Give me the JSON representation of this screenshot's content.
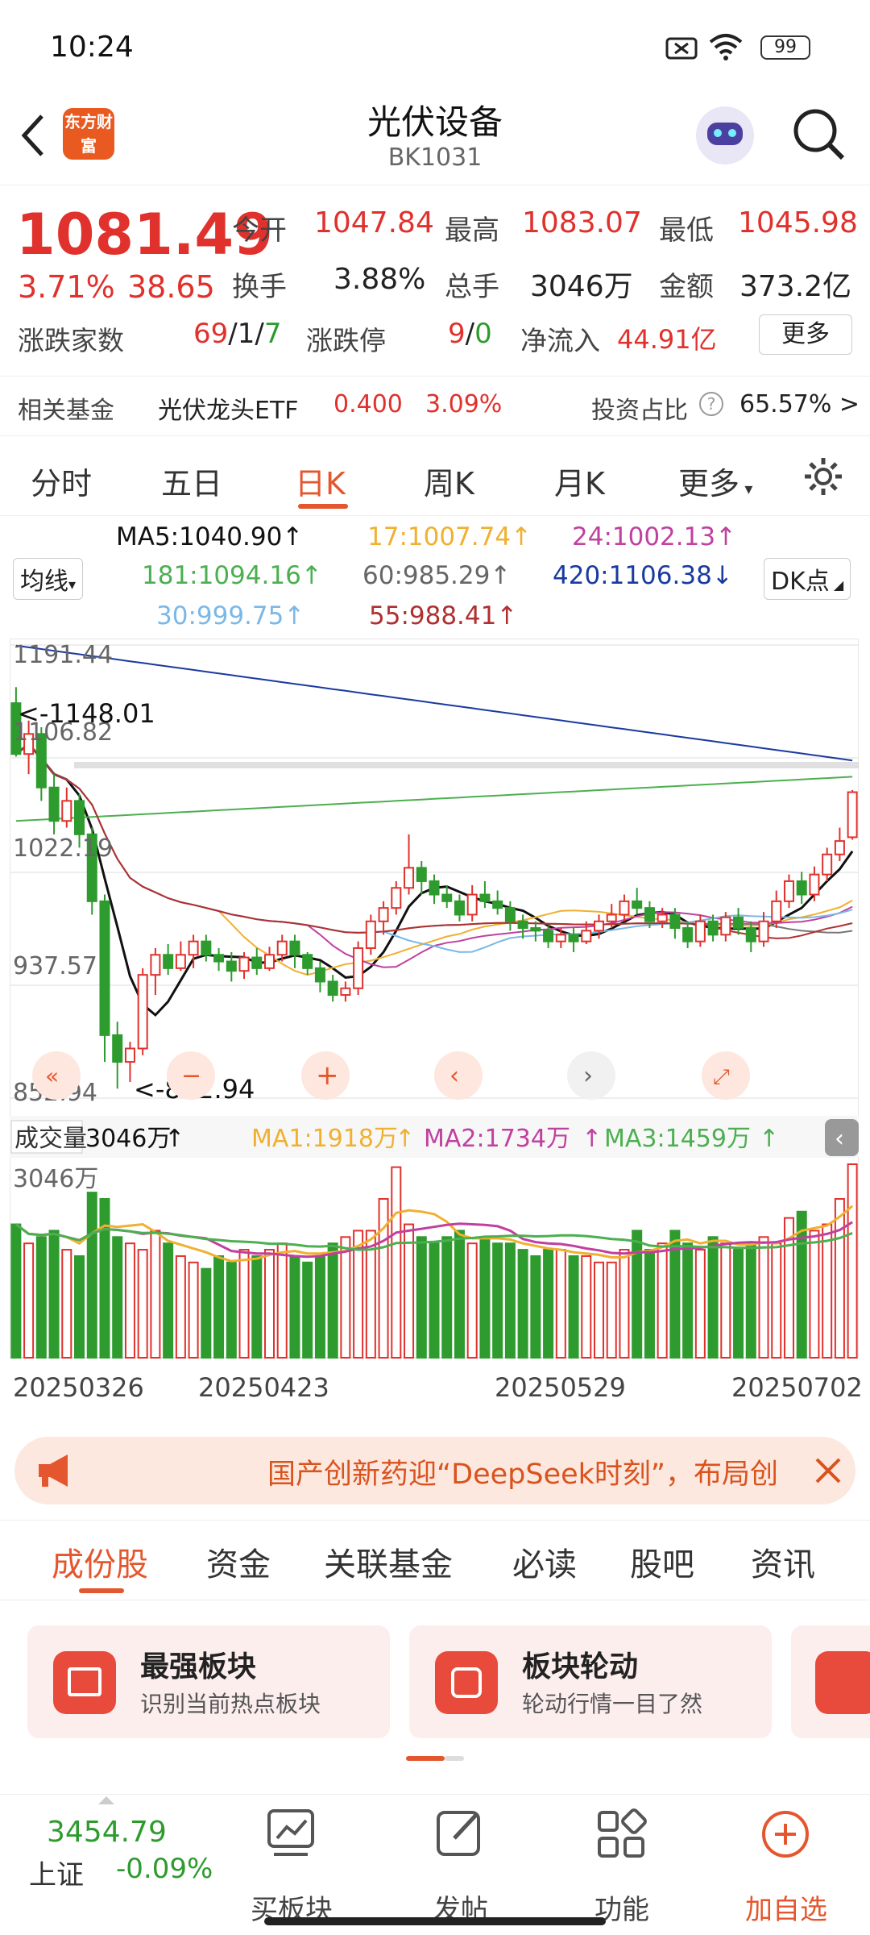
{
  "status_bar": {
    "time": "10:24",
    "battery": "99"
  },
  "header": {
    "title": "光伏设备",
    "code": "BK1031",
    "logo_text": "东方财富"
  },
  "quote": {
    "price": "1081.49",
    "change_pct": "3.71%",
    "change": "38.65",
    "open_label": "今开",
    "open": "1047.84",
    "high_label": "最高",
    "high": "1083.07",
    "low_label": "最低",
    "low": "1045.98",
    "turnover_label": "换手",
    "turnover": "3.88%",
    "volume_label": "总手",
    "volume": "3046万",
    "amount_label": "金额",
    "amount": "373.2亿",
    "breadth_label": "涨跌家数",
    "breadth_up": "69",
    "breadth_flat": "1",
    "breadth_down": "7",
    "limit_label": "涨跌停",
    "limit_up": "9",
    "limit_down": "0",
    "netflow_label": "净流入",
    "netflow": "44.91亿",
    "more_label": "更多"
  },
  "fund": {
    "label": "相关基金",
    "name": "光伏龙头ETF",
    "price": "0.400",
    "pct": "3.09%",
    "ratio_label": "投资占比",
    "ratio": "65.57%"
  },
  "tabs": [
    "分时",
    "五日",
    "日K",
    "周K",
    "月K",
    "更多"
  ],
  "ma": {
    "selector": "均线",
    "ma5": "MA5:1040.90",
    "ma17": "17:1007.74",
    "ma24": "24:1002.13",
    "ma181": "181:1094.16",
    "ma60": "60:985.29",
    "ma420": "420:1106.38",
    "ma30": "30:999.75",
    "ma55": "55:988.41",
    "dk": "DK点"
  },
  "chart_labels": {
    "y_top": "1191.44",
    "y_2": "1106.82",
    "y_3": "1022.19",
    "y_4": "937.57",
    "y_bottom": "852.94",
    "high_mark": "<-1148.01",
    "low_mark": "<-852.94"
  },
  "volume": {
    "selector": "成交量",
    "current": "3046万",
    "ma1": "MA1:1918万",
    "ma2": "MA2:1734万",
    "ma3": "MA3:1459万",
    "axis_max": "3046万"
  },
  "dates": [
    "20250326",
    "20250423",
    "20250529",
    "20250702"
  ],
  "banner": {
    "text": "国产创新药迎“DeepSeek时刻”，布局创"
  },
  "subtabs": [
    "成份股",
    "资金",
    "关联基金",
    "必读",
    "股吧",
    "资讯"
  ],
  "cards": [
    {
      "title": "最强板块",
      "desc": "识别当前热点板块"
    },
    {
      "title": "板块轮动",
      "desc": "轮动行情一目了然"
    }
  ],
  "bottom": {
    "index_value": "3454.79",
    "index_name": "上证",
    "index_pct": "-0.09%",
    "nav": [
      "买板块",
      "发帖",
      "功能",
      "加自选"
    ]
  },
  "colors": {
    "red": "#e0312c",
    "green": "#2e9b2e",
    "accent": "#e4572e"
  },
  "chart_data": {
    "type": "candlestick",
    "ylim": [
      852.94,
      1191.44
    ],
    "candles": [
      [
        1148,
        1110,
        1160,
        1108
      ],
      [
        1110,
        1125,
        1135,
        1095
      ],
      [
        1125,
        1085,
        1130,
        1075
      ],
      [
        1085,
        1060,
        1095,
        1050
      ],
      [
        1060,
        1075,
        1085,
        1055
      ],
      [
        1075,
        1050,
        1080,
        1040
      ],
      [
        1050,
        1000,
        1055,
        990
      ],
      [
        1000,
        900,
        1005,
        880
      ],
      [
        900,
        880,
        910,
        860
      ],
      [
        880,
        890,
        895,
        865
      ],
      [
        890,
        945,
        950,
        885
      ],
      [
        945,
        960,
        965,
        930
      ],
      [
        960,
        950,
        968,
        945
      ],
      [
        950,
        960,
        970,
        948
      ],
      [
        960,
        970,
        975,
        950
      ],
      [
        970,
        960,
        975,
        955
      ],
      [
        960,
        955,
        965,
        948
      ],
      [
        955,
        948,
        962,
        940
      ],
      [
        948,
        958,
        962,
        942
      ],
      [
        958,
        950,
        965,
        945
      ],
      [
        950,
        960,
        966,
        948
      ],
      [
        960,
        970,
        975,
        955
      ],
      [
        970,
        960,
        975,
        950
      ],
      [
        960,
        950,
        962,
        945
      ],
      [
        950,
        940,
        955,
        932
      ],
      [
        940,
        930,
        945,
        925
      ],
      [
        930,
        935,
        940,
        925
      ],
      [
        935,
        965,
        970,
        930
      ],
      [
        965,
        985,
        990,
        960
      ],
      [
        985,
        995,
        1000,
        975
      ],
      [
        995,
        1010,
        1015,
        990
      ],
      [
        1010,
        1025,
        1050,
        1005
      ],
      [
        1025,
        1015,
        1030,
        1005
      ],
      [
        1015,
        1005,
        1020,
        998
      ],
      [
        1005,
        1000,
        1012,
        995
      ],
      [
        1000,
        990,
        1005,
        985
      ],
      [
        990,
        1005,
        1012,
        985
      ],
      [
        1005,
        1000,
        1015,
        995
      ],
      [
        1000,
        995,
        1008,
        990
      ],
      [
        995,
        985,
        1000,
        978
      ],
      [
        985,
        980,
        990,
        972
      ],
      [
        980,
        978,
        985,
        970
      ],
      [
        978,
        970,
        982,
        965
      ],
      [
        970,
        975,
        980,
        965
      ],
      [
        975,
        970,
        980,
        962
      ],
      [
        970,
        978,
        985,
        968
      ],
      [
        978,
        985,
        990,
        972
      ],
      [
        985,
        990,
        998,
        980
      ],
      [
        990,
        1000,
        1005,
        985
      ],
      [
        1000,
        995,
        1010,
        990
      ],
      [
        995,
        985,
        1000,
        980
      ],
      [
        985,
        990,
        995,
        980
      ],
      [
        990,
        980,
        995,
        972
      ],
      [
        980,
        970,
        985,
        965
      ],
      [
        970,
        985,
        990,
        966
      ],
      [
        985,
        975,
        990,
        970
      ],
      [
        975,
        988,
        992,
        970
      ],
      [
        988,
        980,
        995,
        975
      ],
      [
        980,
        970,
        985,
        962
      ],
      [
        970,
        985,
        992,
        966
      ],
      [
        985,
        1000,
        1008,
        980
      ],
      [
        1000,
        1015,
        1020,
        995
      ],
      [
        1015,
        1005,
        1022,
        998
      ],
      [
        1005,
        1020,
        1026,
        1000
      ],
      [
        1020,
        1035,
        1040,
        1015
      ],
      [
        1035,
        1045,
        1055,
        1030
      ],
      [
        1047.84,
        1081.49,
        1083.07,
        1045.98
      ]
    ],
    "ma_series": [
      {
        "name": "MA5",
        "color": "#111111"
      },
      {
        "name": "17",
        "color": "#f0b030"
      },
      {
        "name": "24",
        "color": "#c040a0"
      },
      {
        "name": "181",
        "color": "#4caf50"
      },
      {
        "name": "60",
        "color": "#777777"
      },
      {
        "name": "420",
        "color": "#1a3aa0"
      },
      {
        "name": "30",
        "color": "#7ab8e8"
      },
      {
        "name": "55",
        "color": "#b03030"
      }
    ],
    "volume_values": [
      2100,
      1800,
      1900,
      2000,
      1700,
      1600,
      2600,
      2500,
      1900,
      1800,
      1700,
      2000,
      1800,
      1600,
      1500,
      1400,
      1600,
      1500,
      1700,
      1600,
      1700,
      1800,
      1600,
      1500,
      1600,
      1800,
      1900,
      2000,
      2000,
      2500,
      3000,
      2100,
      1900,
      1800,
      1900,
      2000,
      1800,
      1900,
      1800,
      1800,
      1700,
      1600,
      1700,
      1700,
      1600,
      1600,
      1500,
      1500,
      1700,
      2000,
      1700,
      1800,
      2000,
      1800,
      1700,
      1900,
      1800,
      1700,
      1800,
      1900,
      1800,
      2200,
      2300,
      2000,
      2100,
      2500,
      3046
    ]
  }
}
